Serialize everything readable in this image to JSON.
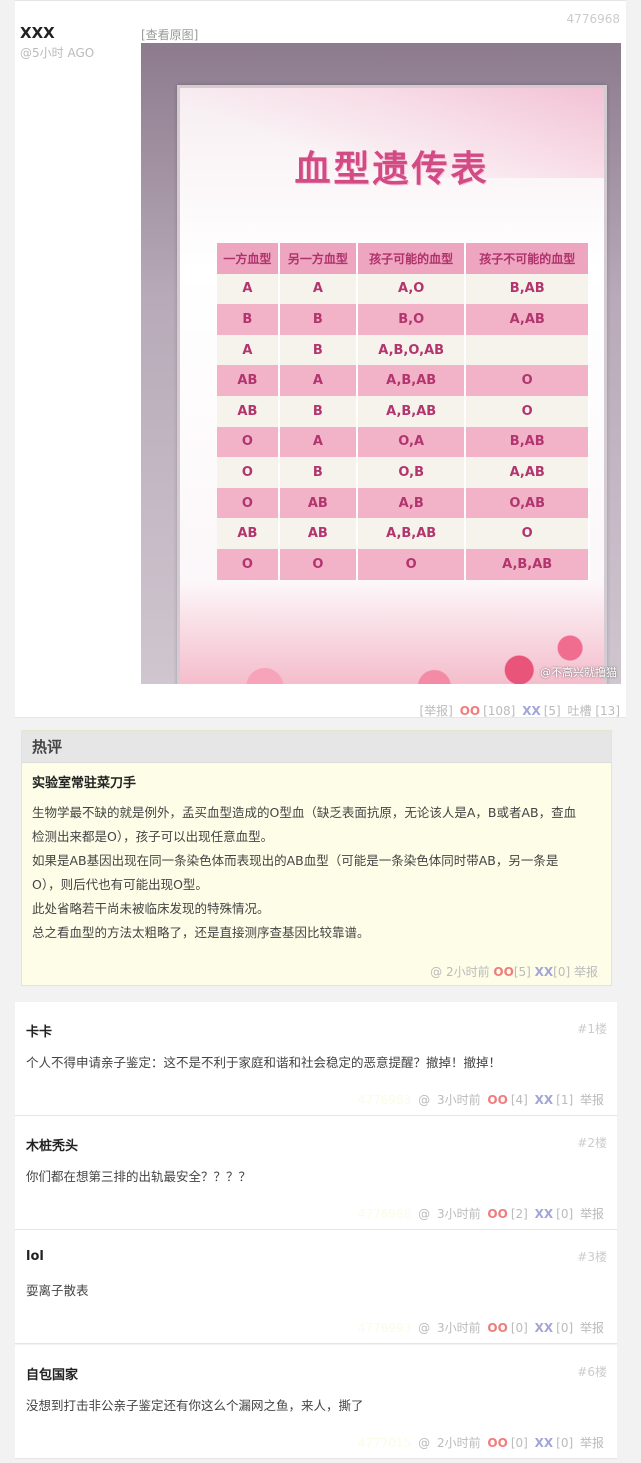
{
  "post": {
    "author": "XXX",
    "time": "@5小时 AGO",
    "id": "4776968",
    "view_original": "[查看原图]",
    "image": {
      "title": "血型遗传表",
      "headers": [
        "一方血型",
        "另一方血型",
        "孩子可能的血型",
        "孩子不可能的血型"
      ],
      "rows": [
        [
          "A",
          "A",
          "A,O",
          "B,AB"
        ],
        [
          "B",
          "B",
          "B,O",
          "A,AB"
        ],
        [
          "A",
          "B",
          "A,B,O,AB",
          ""
        ],
        [
          "AB",
          "A",
          "A,B,AB",
          "O"
        ],
        [
          "AB",
          "B",
          "A,B,AB",
          "O"
        ],
        [
          "O",
          "A",
          "O,A",
          "B,AB"
        ],
        [
          "O",
          "B",
          "O,B",
          "A,AB"
        ],
        [
          "O",
          "AB",
          "A,B",
          "O,AB"
        ],
        [
          "AB",
          "AB",
          "A,B,AB",
          "O"
        ],
        [
          "O",
          "O",
          "O",
          "A,B,AB"
        ]
      ],
      "watermark": "@不高兴就撸猫"
    },
    "actions": {
      "report": "[举报]",
      "oo_label": "OO",
      "oo_count": "[108]",
      "xx_label": "XX",
      "xx_count": "[5]",
      "tucao": "吐槽 [13]"
    }
  },
  "hot": {
    "header": "热评",
    "author": "实验室常驻菜刀手",
    "lines": [
      "生物学最不缺的就是例外，孟买血型造成的O型血（缺乏表面抗原，无论该人是A，B或者AB，查血",
      "检测出来都是O），孩子可以出现任意血型。",
      "如果是AB基因出现在同一条染色体而表现出的AB血型（可能是一条染色体同时带AB，另一条是",
      "O），则后代也有可能出现O型。",
      "此处省略若干尚未被临床发现的特殊情况。",
      "总之看血型的方法太粗略了，还是直接测序查基因比较靠谱。"
    ],
    "actions": {
      "at": "@",
      "time": "2小时前",
      "oo": "OO",
      "oo_count": "[5]",
      "xx": "XX",
      "xx_count": "[0]",
      "report": "举报"
    }
  },
  "comments": [
    {
      "author": "卡卡",
      "floor": "#1楼",
      "text": "个人不得申请亲子鉴定：这不是不利于家庭和谐和社会稳定的恶意提醒？撤掉！撤掉！",
      "hidden_id": "4776983",
      "time": "3小时前",
      "oo_count": "[4]",
      "xx_count": "[1]"
    },
    {
      "author": "木桩秃头",
      "floor": "#2楼",
      "text": "你们都在想第三排的出轨最安全？？？？",
      "hidden_id": "4776988",
      "time": "3小时前",
      "oo_count": "[2]",
      "xx_count": "[0]"
    },
    {
      "author": "lol",
      "floor": "#3楼",
      "text": "耍离子散表",
      "hidden_id": "4776993",
      "time": "3小时前",
      "oo_count": "[0]",
      "xx_count": "[0]"
    },
    {
      "author": "自包国家",
      "floor": "#6楼",
      "text": "没想到打击非公亲子鉴定还有你这么个漏网之鱼，来人，撕了",
      "hidden_id": "4777015",
      "time": "2小时前",
      "oo_count": "[0]",
      "xx_count": "[0]"
    }
  ],
  "comment_labels": {
    "at": "@",
    "oo": "OO",
    "xx": "XX",
    "report": "举报"
  }
}
